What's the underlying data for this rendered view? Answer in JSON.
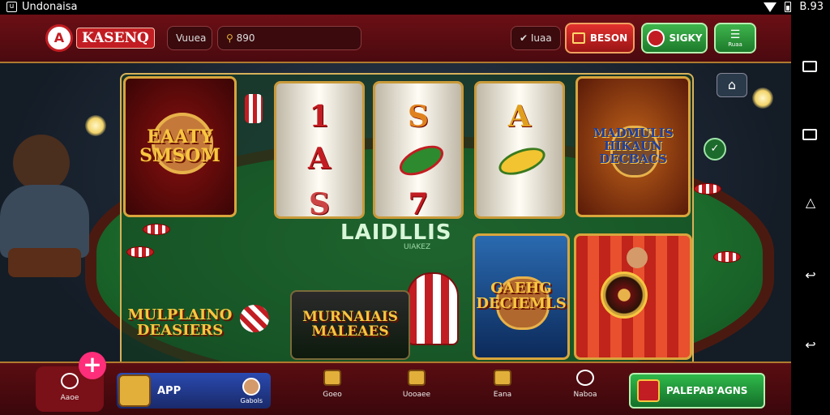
{
  "status_bar": {
    "carrier": "Undonaisa",
    "time": "B.93"
  },
  "header": {
    "logo_text": "KASENQ",
    "nav_label": "Vuuea",
    "search_text": "890",
    "pill_label": "✔ Iuaa",
    "balance_label": "BESON",
    "profile_label": "SIGKY",
    "menu_sub": "Ruaa"
  },
  "games": {
    "tile1": "EAATY SMSOM",
    "tile2": "MADMULIS HIKAUN DECBACS",
    "reels": [
      {
        "top": "1",
        "mid": "A",
        "bottom": "S"
      },
      {
        "top": "S",
        "mid": "•",
        "bottom": "7"
      },
      {
        "top": "A",
        "mid": "•",
        "bottom": ""
      }
    ],
    "center_title": "LAIDLLIS",
    "center_sub": "UIAKEZ",
    "tile3": "MULPLAINO DEASIERS",
    "tile4": "MURNAIAIS MALEAES",
    "tile5": "GAEHG DECIEMLS",
    "tile6": ""
  },
  "bottom": {
    "home_label": "Aaoe",
    "app_label": "APP",
    "app_side": "Gabols",
    "item1": "Goeo",
    "item2": "Uooaee",
    "item3": "Eana",
    "item4": "Naboa",
    "cta_label": "PALEPAB'AGNS"
  },
  "colors": {
    "brand_red": "#c21d22",
    "gold": "#d9a53c",
    "green_cta": "#1f9a39"
  }
}
